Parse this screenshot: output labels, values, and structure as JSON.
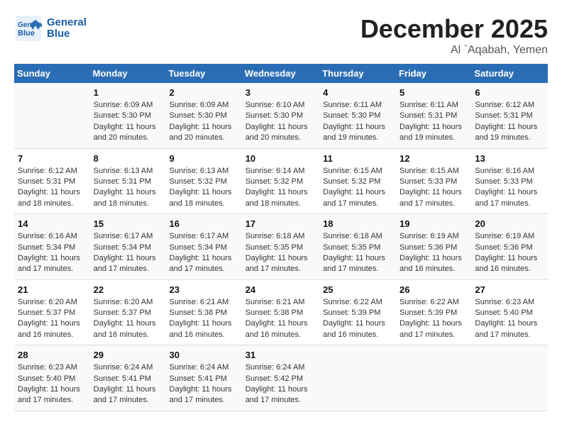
{
  "header": {
    "logo_general": "General",
    "logo_blue": "Blue",
    "month": "December 2025",
    "location": "Al `Aqabah, Yemen"
  },
  "days_of_week": [
    "Sunday",
    "Monday",
    "Tuesday",
    "Wednesday",
    "Thursday",
    "Friday",
    "Saturday"
  ],
  "weeks": [
    [
      {
        "num": "",
        "sunrise": "",
        "sunset": "",
        "daylight": ""
      },
      {
        "num": "1",
        "sunrise": "Sunrise: 6:09 AM",
        "sunset": "Sunset: 5:30 PM",
        "daylight": "Daylight: 11 hours and 20 minutes."
      },
      {
        "num": "2",
        "sunrise": "Sunrise: 6:09 AM",
        "sunset": "Sunset: 5:30 PM",
        "daylight": "Daylight: 11 hours and 20 minutes."
      },
      {
        "num": "3",
        "sunrise": "Sunrise: 6:10 AM",
        "sunset": "Sunset: 5:30 PM",
        "daylight": "Daylight: 11 hours and 20 minutes."
      },
      {
        "num": "4",
        "sunrise": "Sunrise: 6:11 AM",
        "sunset": "Sunset: 5:30 PM",
        "daylight": "Daylight: 11 hours and 19 minutes."
      },
      {
        "num": "5",
        "sunrise": "Sunrise: 6:11 AM",
        "sunset": "Sunset: 5:31 PM",
        "daylight": "Daylight: 11 hours and 19 minutes."
      },
      {
        "num": "6",
        "sunrise": "Sunrise: 6:12 AM",
        "sunset": "Sunset: 5:31 PM",
        "daylight": "Daylight: 11 hours and 19 minutes."
      }
    ],
    [
      {
        "num": "7",
        "sunrise": "Sunrise: 6:12 AM",
        "sunset": "Sunset: 5:31 PM",
        "daylight": "Daylight: 11 hours and 18 minutes."
      },
      {
        "num": "8",
        "sunrise": "Sunrise: 6:13 AM",
        "sunset": "Sunset: 5:31 PM",
        "daylight": "Daylight: 11 hours and 18 minutes."
      },
      {
        "num": "9",
        "sunrise": "Sunrise: 6:13 AM",
        "sunset": "Sunset: 5:32 PM",
        "daylight": "Daylight: 11 hours and 18 minutes."
      },
      {
        "num": "10",
        "sunrise": "Sunrise: 6:14 AM",
        "sunset": "Sunset: 5:32 PM",
        "daylight": "Daylight: 11 hours and 18 minutes."
      },
      {
        "num": "11",
        "sunrise": "Sunrise: 6:15 AM",
        "sunset": "Sunset: 5:32 PM",
        "daylight": "Daylight: 11 hours and 17 minutes."
      },
      {
        "num": "12",
        "sunrise": "Sunrise: 6:15 AM",
        "sunset": "Sunset: 5:33 PM",
        "daylight": "Daylight: 11 hours and 17 minutes."
      },
      {
        "num": "13",
        "sunrise": "Sunrise: 6:16 AM",
        "sunset": "Sunset: 5:33 PM",
        "daylight": "Daylight: 11 hours and 17 minutes."
      }
    ],
    [
      {
        "num": "14",
        "sunrise": "Sunrise: 6:16 AM",
        "sunset": "Sunset: 5:34 PM",
        "daylight": "Daylight: 11 hours and 17 minutes."
      },
      {
        "num": "15",
        "sunrise": "Sunrise: 6:17 AM",
        "sunset": "Sunset: 5:34 PM",
        "daylight": "Daylight: 11 hours and 17 minutes."
      },
      {
        "num": "16",
        "sunrise": "Sunrise: 6:17 AM",
        "sunset": "Sunset: 5:34 PM",
        "daylight": "Daylight: 11 hours and 17 minutes."
      },
      {
        "num": "17",
        "sunrise": "Sunrise: 6:18 AM",
        "sunset": "Sunset: 5:35 PM",
        "daylight": "Daylight: 11 hours and 17 minutes."
      },
      {
        "num": "18",
        "sunrise": "Sunrise: 6:18 AM",
        "sunset": "Sunset: 5:35 PM",
        "daylight": "Daylight: 11 hours and 17 minutes."
      },
      {
        "num": "19",
        "sunrise": "Sunrise: 6:19 AM",
        "sunset": "Sunset: 5:36 PM",
        "daylight": "Daylight: 11 hours and 16 minutes."
      },
      {
        "num": "20",
        "sunrise": "Sunrise: 6:19 AM",
        "sunset": "Sunset: 5:36 PM",
        "daylight": "Daylight: 11 hours and 16 minutes."
      }
    ],
    [
      {
        "num": "21",
        "sunrise": "Sunrise: 6:20 AM",
        "sunset": "Sunset: 5:37 PM",
        "daylight": "Daylight: 11 hours and 16 minutes."
      },
      {
        "num": "22",
        "sunrise": "Sunrise: 6:20 AM",
        "sunset": "Sunset: 5:37 PM",
        "daylight": "Daylight: 11 hours and 16 minutes."
      },
      {
        "num": "23",
        "sunrise": "Sunrise: 6:21 AM",
        "sunset": "Sunset: 5:38 PM",
        "daylight": "Daylight: 11 hours and 16 minutes."
      },
      {
        "num": "24",
        "sunrise": "Sunrise: 6:21 AM",
        "sunset": "Sunset: 5:38 PM",
        "daylight": "Daylight: 11 hours and 16 minutes."
      },
      {
        "num": "25",
        "sunrise": "Sunrise: 6:22 AM",
        "sunset": "Sunset: 5:39 PM",
        "daylight": "Daylight: 11 hours and 16 minutes."
      },
      {
        "num": "26",
        "sunrise": "Sunrise: 6:22 AM",
        "sunset": "Sunset: 5:39 PM",
        "daylight": "Daylight: 11 hours and 17 minutes."
      },
      {
        "num": "27",
        "sunrise": "Sunrise: 6:23 AM",
        "sunset": "Sunset: 5:40 PM",
        "daylight": "Daylight: 11 hours and 17 minutes."
      }
    ],
    [
      {
        "num": "28",
        "sunrise": "Sunrise: 6:23 AM",
        "sunset": "Sunset: 5:40 PM",
        "daylight": "Daylight: 11 hours and 17 minutes."
      },
      {
        "num": "29",
        "sunrise": "Sunrise: 6:24 AM",
        "sunset": "Sunset: 5:41 PM",
        "daylight": "Daylight: 11 hours and 17 minutes."
      },
      {
        "num": "30",
        "sunrise": "Sunrise: 6:24 AM",
        "sunset": "Sunset: 5:41 PM",
        "daylight": "Daylight: 11 hours and 17 minutes."
      },
      {
        "num": "31",
        "sunrise": "Sunrise: 6:24 AM",
        "sunset": "Sunset: 5:42 PM",
        "daylight": "Daylight: 11 hours and 17 minutes."
      },
      {
        "num": "",
        "sunrise": "",
        "sunset": "",
        "daylight": ""
      },
      {
        "num": "",
        "sunrise": "",
        "sunset": "",
        "daylight": ""
      },
      {
        "num": "",
        "sunrise": "",
        "sunset": "",
        "daylight": ""
      }
    ]
  ]
}
